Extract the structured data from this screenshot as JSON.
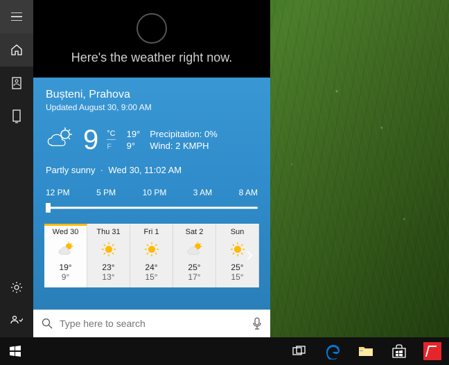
{
  "cortana": {
    "prompt": "Here's the weather right now."
  },
  "weather": {
    "location": "Bușteni, Prahova",
    "updated": "Updated August 30, 9:00 AM",
    "temp": "9",
    "unit_c": "°C",
    "unit_f": "F",
    "hi": "19°",
    "lo": "9°",
    "precip_label": "Precipitation: 0%",
    "wind_label": "Wind: 2 KMPH",
    "condition": "Partly sunny",
    "sep": "·",
    "cond_time": "Wed 30, 11:02 AM",
    "timeline": [
      "12 PM",
      "5 PM",
      "10 PM",
      "3 AM",
      "8 AM"
    ],
    "forecast": [
      {
        "day": "Wed 30",
        "icon": "partly",
        "hi": "19°",
        "lo": "9°",
        "selected": true
      },
      {
        "day": "Thu 31",
        "icon": "sunny",
        "hi": "23°",
        "lo": "13°"
      },
      {
        "day": "Fri 1",
        "icon": "sunny",
        "hi": "24°",
        "lo": "15°"
      },
      {
        "day": "Sat 2",
        "icon": "partly",
        "hi": "25°",
        "lo": "17°"
      },
      {
        "day": "Sun",
        "icon": "sunny",
        "hi": "25°",
        "lo": "15°"
      }
    ]
  },
  "search": {
    "placeholder": "Type here to search"
  }
}
